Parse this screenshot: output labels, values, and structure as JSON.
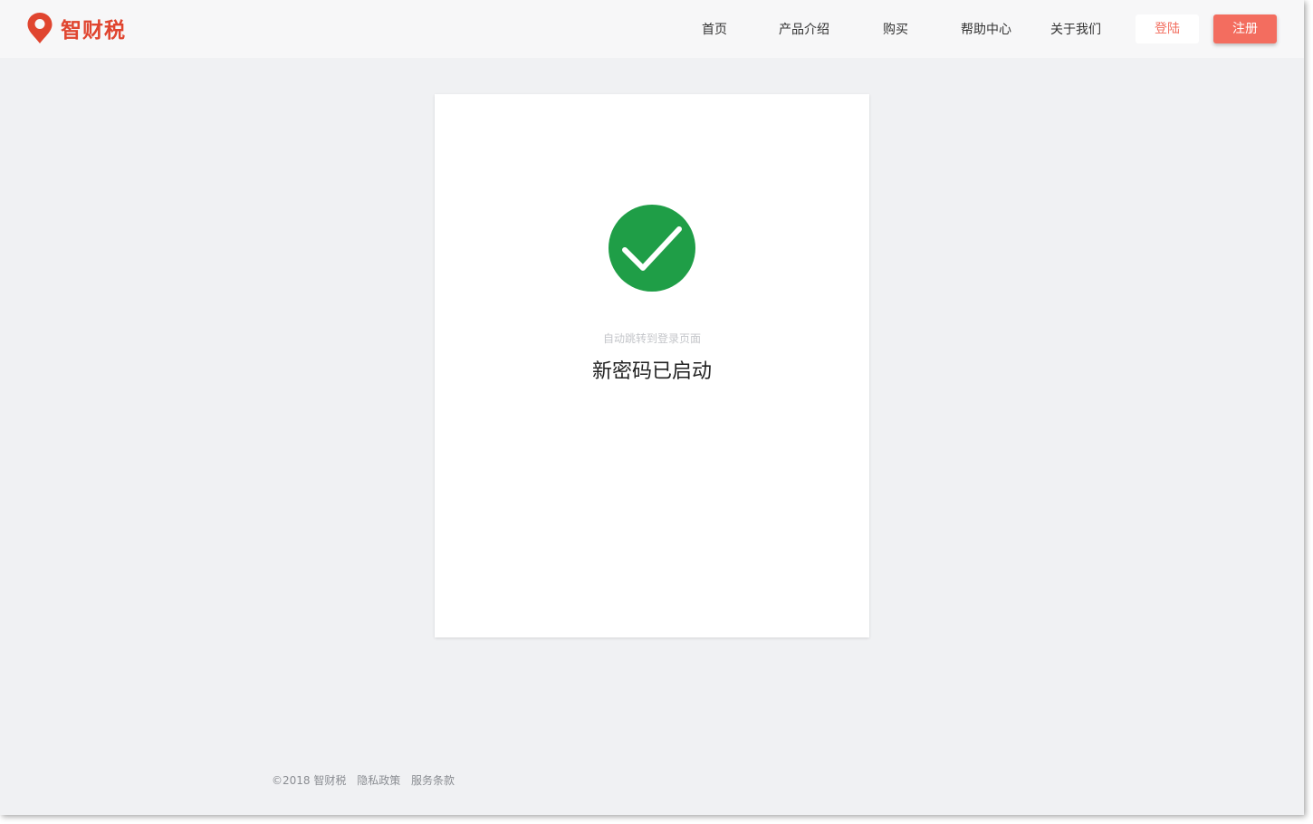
{
  "header": {
    "brand": "智财税",
    "nav": [
      "首页",
      "产品介绍",
      "购买",
      "帮助中心",
      "关于我们"
    ],
    "login_label": "登陆",
    "register_label": "注册"
  },
  "main": {
    "redirect_hint": "自动跳转到登录页面",
    "success_message": "新密码已启动"
  },
  "footer": {
    "copyright": "©2018 智财税",
    "privacy": "隐私政策",
    "terms": "服务条款"
  },
  "colors": {
    "brand": "#e0452f",
    "accent": "#f36d5f",
    "success": "#1f9e47"
  },
  "icons": {
    "logo": "location-pin-icon",
    "status": "check-circle-icon"
  }
}
